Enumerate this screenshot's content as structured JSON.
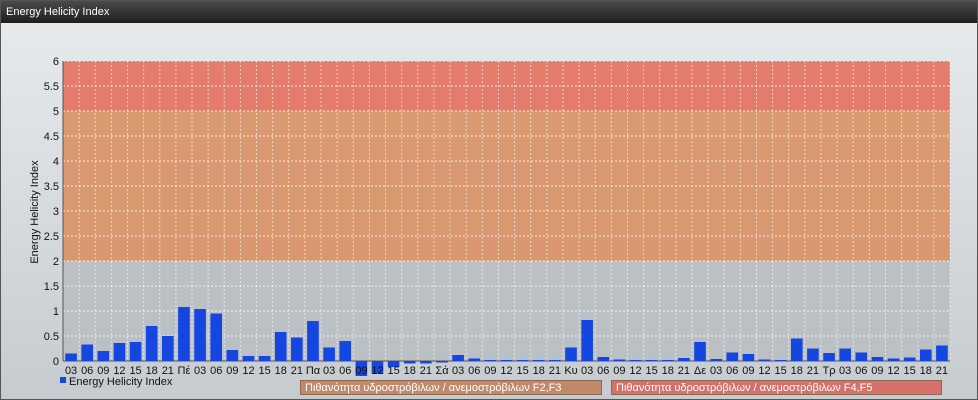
{
  "window": {
    "title": "Energy Helicity Index"
  },
  "colors": {
    "bar": "#1546e0",
    "band_low": "#cc9e7c",
    "band_mid": "#d88c5d",
    "band_high": "#e46a55",
    "grid": "#ffffff"
  },
  "legend": {
    "series_label": "Energy Helicity Index",
    "band1_label": "Πιθανότητα υδροστρόβιλων / ανεμοστρόβιλων F2,F3",
    "band2_label": "Πιθανότητα υδροστρόβιλων / ανεμοστρόβιλων F4,F5"
  },
  "chart_data": {
    "type": "bar",
    "title": "",
    "xlabel": "",
    "ylabel": "Energy Helicity Index",
    "ylim": [
      0,
      6
    ],
    "yticks": [
      "0",
      "0.5",
      "1",
      "1.5",
      "2",
      "2.5",
      "3",
      "3.5",
      "4",
      "4.5",
      "5",
      "5.5",
      "6"
    ],
    "grid": true,
    "legend_position": "bottom-left",
    "bands": [
      {
        "from": 2,
        "to": 5,
        "label": "Πιθανότητα υδροστρόβιλων / ανεμοστρόβιλων F2,F3"
      },
      {
        "from": 5,
        "to": 6,
        "label": "Πιθανότητα υδροστρόβιλων / ανεμοστρόβιλων F4,F5"
      }
    ],
    "categories": [
      "03",
      "06",
      "09",
      "12",
      "15",
      "18",
      "21",
      "Πέ",
      "03",
      "06",
      "09",
      "12",
      "15",
      "18",
      "21",
      "Πα",
      "03",
      "06",
      "09",
      "12",
      "15",
      "18",
      "21",
      "Σά",
      "03",
      "06",
      "09",
      "12",
      "15",
      "18",
      "21",
      "Κυ",
      "03",
      "06",
      "09",
      "12",
      "15",
      "18",
      "21",
      "Δε",
      "03",
      "06",
      "09",
      "12",
      "15",
      "18",
      "21",
      "Τρ",
      "03",
      "06",
      "09",
      "12",
      "15",
      "18",
      "21"
    ],
    "series": [
      {
        "name": "Energy Helicity Index",
        "values": [
          0.15,
          0.33,
          0.2,
          0.36,
          0.38,
          0.7,
          0.5,
          1.08,
          1.04,
          0.95,
          0.22,
          0.1,
          0.1,
          0.58,
          0.47,
          0.8,
          0.27,
          0.4,
          -0.3,
          -0.25,
          -0.12,
          -0.05,
          -0.05,
          -0.03,
          0.12,
          0.05,
          0.02,
          0.02,
          0.02,
          0.02,
          0.02,
          0.27,
          0.82,
          0.08,
          0.03,
          0.02,
          0.02,
          0.02,
          0.06,
          0.38,
          0.04,
          0.17,
          0.14,
          0.03,
          0.02,
          0.45,
          0.25,
          0.16,
          0.25,
          0.17,
          0.08,
          0.05,
          0.07,
          0.23,
          0.31
        ]
      }
    ]
  }
}
